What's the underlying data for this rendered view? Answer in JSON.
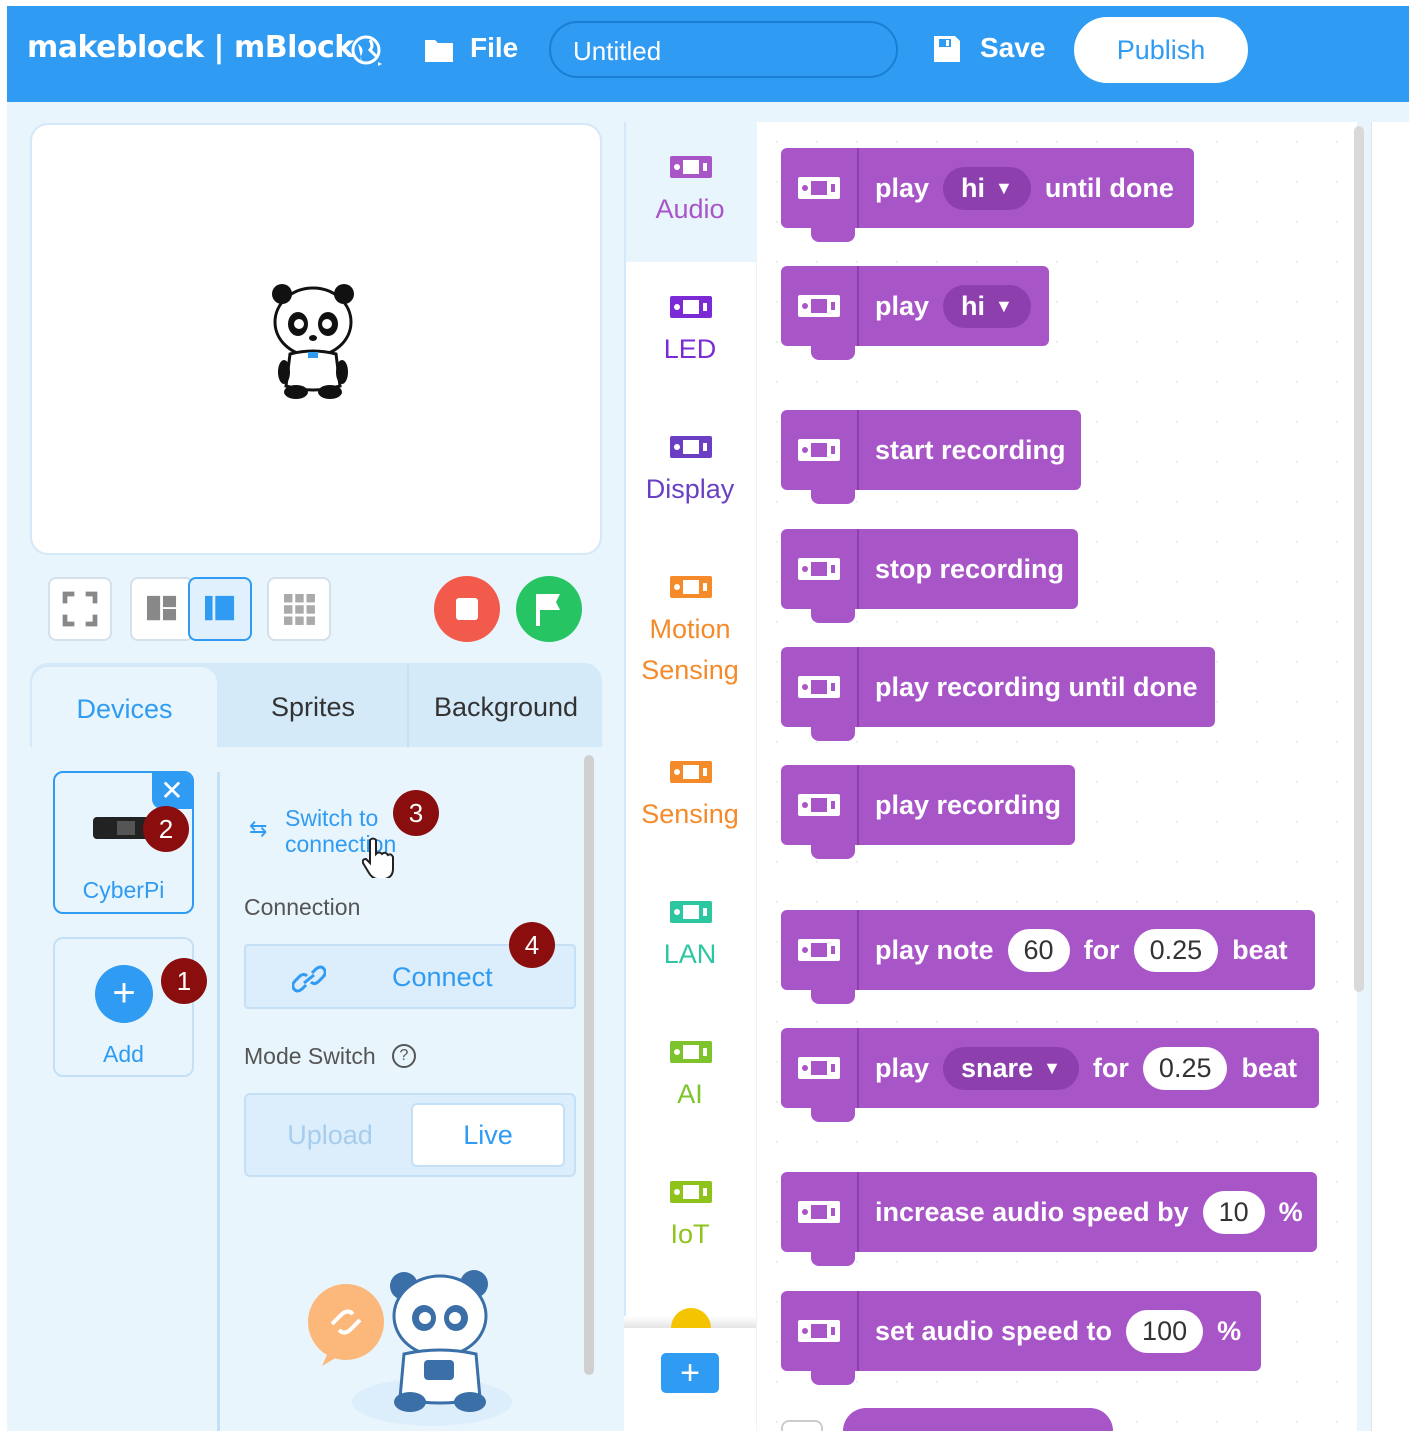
{
  "topbar": {
    "brand": "makeblock | mBlock",
    "file_label": "File",
    "project_title": "Untitled",
    "save_label": "Save",
    "publish_label": "Publish"
  },
  "tabs": {
    "devices": "Devices",
    "sprites": "Sprites",
    "background": "Background"
  },
  "devices": {
    "device_name": "CyberPi",
    "add_label": "Add",
    "switch_text_1": "Switch to",
    "switch_text_2": "t",
    "switch_text_3": "connection",
    "connection_label": "Connection",
    "connect_label": "Connect",
    "mode_switch_label": "Mode Switch",
    "upload_label": "Upload",
    "live_label": "Live"
  },
  "badges": [
    "1",
    "2",
    "3",
    "4"
  ],
  "categories": [
    {
      "label": "Audio",
      "color": "#a855c8"
    },
    {
      "label": "LED",
      "color": "#7b2bd6"
    },
    {
      "label": "Display",
      "color": "#6a3fc4"
    },
    {
      "label": "Motion",
      "label2": "Sensing",
      "color": "#f58a2a"
    },
    {
      "label": "Sensing",
      "color": "#f58a2a"
    },
    {
      "label": "LAN",
      "color": "#2cc6a0"
    },
    {
      "label": "AI",
      "color": "#7dc42c"
    },
    {
      "label": "IoT",
      "color": "#8fc21a"
    }
  ],
  "blocks": {
    "b1": {
      "play": "play",
      "drop": "hi",
      "tail": "until done"
    },
    "b2": {
      "play": "play",
      "drop": "hi"
    },
    "b3": "start recording",
    "b4": "stop recording",
    "b5": "play recording until done",
    "b6": "play recording",
    "b7": {
      "a": "play note",
      "n1": "60",
      "b": "for",
      "n2": "0.25",
      "c": "beat"
    },
    "b8": {
      "a": "play",
      "drop": "snare",
      "b": "for",
      "n2": "0.25",
      "c": "beat"
    },
    "b9": {
      "a": "increase audio speed by",
      "n1": "10",
      "c": "%"
    },
    "b10": {
      "a": "set audio speed to",
      "n1": "100",
      "c": "%"
    }
  },
  "colors": {
    "topbar": "#2f9bf2",
    "block": "#a855c8",
    "stop": "#f25b4b",
    "go": "#27c463",
    "badge": "#8b0e0e"
  }
}
